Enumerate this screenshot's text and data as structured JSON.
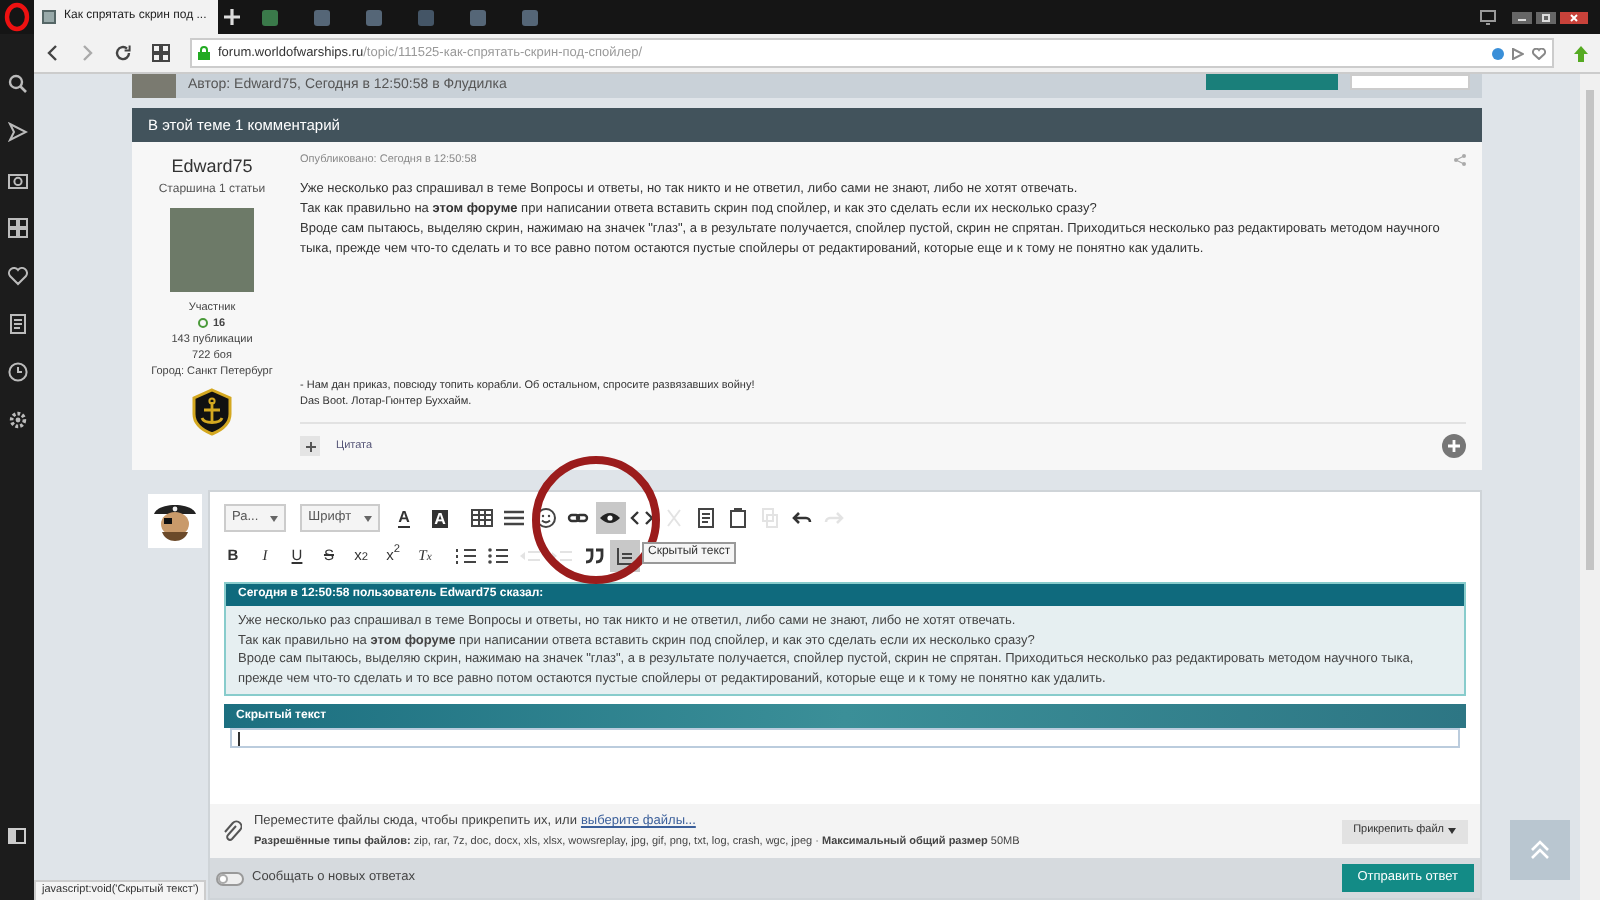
{
  "browser": {
    "tabs": [
      {
        "title": "Как спрятать скрин под ...",
        "selected": true
      }
    ],
    "address": {
      "domain": "forum.worldofwarships.ru",
      "path": "/topic/111525-как-спрятать-скрин-под-спойлер/"
    }
  },
  "topic": {
    "meta": "Автор: Edward75, Сегодня в 12:50:58 в Флудилка"
  },
  "comments_bar": "В этой теме 1 комментарий",
  "post": {
    "author": {
      "name": "Edward75",
      "rank": "Старшина 1 статьи",
      "group": "Участник",
      "reputation": "16",
      "posts": "143 публикации",
      "battles": "722 боя",
      "city": "Город: Санкт Петербург"
    },
    "published": "Опубликовано: Сегодня в 12:50:58",
    "body": [
      "Уже несколько раз спрашивал в теме Вопросы и ответы, но так никто и не ответил, либо сами не знают, либо не хотят отвечать.",
      "Так как правильно на **этом форуме** при написании ответа вставить скрин под спойлер, и как это сделать если их несколько сразу?",
      "Вроде сам пытаюсь, выделяю скрин, нажимаю на значек \"глаз\", а в результате получается, спойлер пустой, скрин не спрятан. Приходиться несколько раз редактировать методом научного тыка, прежде чем что-то сделать и то все равно потом остаются пустые спойлеры от редактирований, которые еще и к тому не понятно как удалить."
    ],
    "signature": [
      "- Нам дан приказ, повсюду топить корабли. Об остальном, спросите развязавших войну!",
      "Das Boot. Лотар-Гюнтер Буххайм."
    ],
    "quote_button": "Цитата"
  },
  "editor": {
    "toolbar_rows": [
      [
        {
          "kind": "select",
          "label": "Ра...",
          "selected": false,
          "disabled": false
        },
        {
          "kind": "select",
          "label": "Шрифт",
          "selected": false,
          "disabled": false
        },
        {
          "kind": "color",
          "label": "A",
          "selected": false,
          "disabled": false
        },
        {
          "kind": "bgcolor",
          "label": "A",
          "selected": false,
          "disabled": false
        },
        {
          "kind": "table",
          "selected": false,
          "disabled": false
        },
        {
          "kind": "hr",
          "selected": false,
          "disabled": false
        },
        {
          "kind": "emoji",
          "selected": false,
          "disabled": false
        },
        {
          "kind": "link",
          "selected": false,
          "disabled": false
        },
        {
          "kind": "eye",
          "selected": true,
          "disabled": false
        },
        {
          "kind": "code",
          "selected": false,
          "disabled": false
        },
        {
          "kind": "cut",
          "selected": false,
          "disabled": true
        },
        {
          "kind": "paste",
          "selected": false,
          "disabled": false
        },
        {
          "kind": "clipboard",
          "selected": false,
          "disabled": false
        },
        {
          "kind": "copy",
          "selected": false,
          "disabled": true
        },
        {
          "kind": "undo",
          "selected": false,
          "disabled": false
        },
        {
          "kind": "redo",
          "selected": false,
          "disabled": true
        }
      ],
      [
        {
          "kind": "bold",
          "label": "B",
          "selected": false,
          "disabled": false
        },
        {
          "kind": "italic",
          "label": "I",
          "selected": false,
          "disabled": false
        },
        {
          "kind": "underline",
          "label": "U",
          "selected": false,
          "disabled": false
        },
        {
          "kind": "strike",
          "label": "S",
          "selected": false,
          "disabled": false
        },
        {
          "kind": "sub",
          "label": "x$_{2}$",
          "selected": false,
          "disabled": false
        },
        {
          "kind": "sup",
          "label": "x$^{2}$",
          "selected": false,
          "disabled": false
        },
        {
          "kind": "clear",
          "label": "T$_{x}$",
          "selected": false,
          "disabled": false
        },
        {
          "kind": "ol",
          "selected": false,
          "disabled": false
        },
        {
          "kind": "ul",
          "selected": false,
          "disabled": false
        },
        {
          "kind": "outdent",
          "selected": false,
          "disabled": true
        },
        {
          "kind": "indent",
          "selected": false,
          "disabled": true
        },
        {
          "kind": "quote",
          "selected": false,
          "disabled": false
        },
        {
          "kind": "hidden",
          "selected": true,
          "disabled": false
        }
      ]
    ],
    "tooltip": "Скрытый текст",
    "quote": {
      "header": "Сегодня в 12:50:58 пользователь Edward75 сказал:",
      "body": [
        "Уже несколько раз спрашивал в теме Вопросы и ответы, но так никто и не ответил, либо сами не знают, либо не хотят отвечать.",
        "Так как правильно на **этом форуме** при написании ответа вставить скрин под спойлер, и как это сделать если их несколько сразу?",
        "Вроде сам пытаюсь, выделяю скрин, нажимаю на значек \"глаз\", а в результате получается, спойлер пустой, скрин не спрятан. Приходиться несколько раз редактировать методом научного тыка, прежде чем что-то сделать и то все равно потом остаются пустые спойлеры от редактирований, которые еще и к тому не понятно как удалить."
      ]
    },
    "spoiler": {
      "header": "Скрытый текст"
    },
    "attach": {
      "text": "Переместите файлы сюда, чтобы прикрепить их, или",
      "link": "выберите файлы...",
      "types": "**Разрешённые типы файлов:** zip, rar, 7z, doc, docx, xls, xlsx, wowsreplay, jpg, gif, png, txt, log, crash, wgc, jpeg · **Максимальный общий размер** 50MB",
      "button": "Прикрепить файл"
    },
    "notify": {
      "label": "Сообщать о новых ответах",
      "on": false
    },
    "submit": "Отправить ответ"
  },
  "status_url": "javascript:void('Скрытый текст')"
}
